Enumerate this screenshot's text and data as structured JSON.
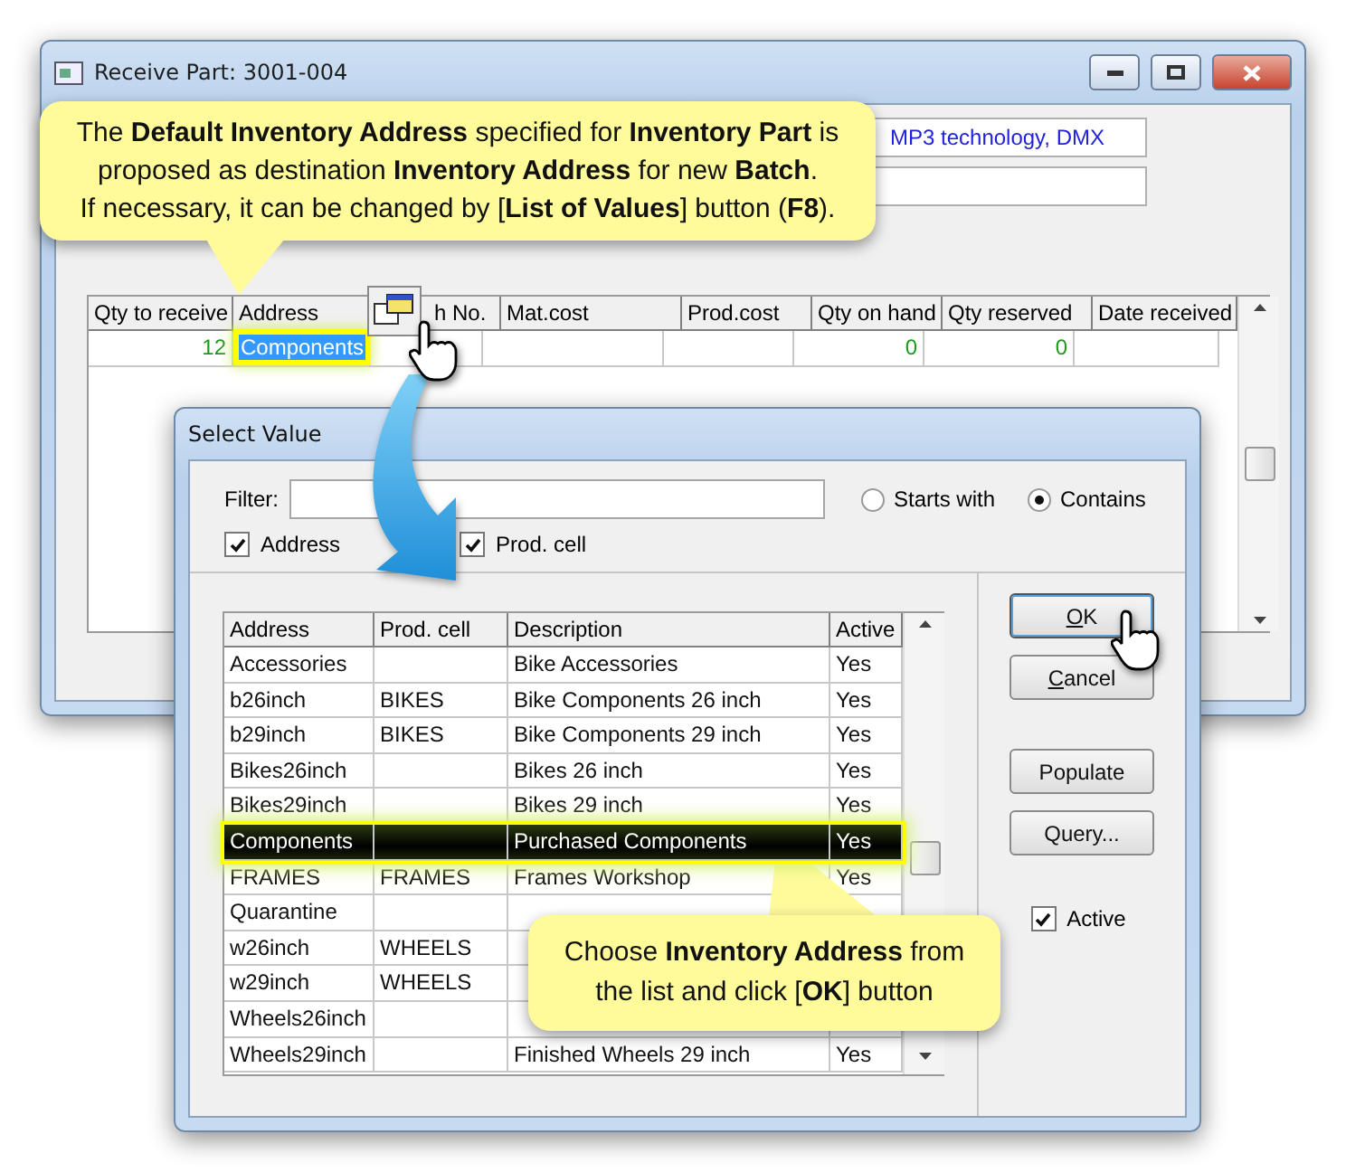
{
  "main_window": {
    "title": "Receive Part: 3001-004",
    "fields": [
      {
        "value": "MP3 technology, DMX"
      }
    ],
    "grid": {
      "columns": [
        "Qty to receive",
        "Address",
        "h No.",
        "Mat.cost",
        "Prod.cost",
        "Qty on hand",
        "Qty reserved",
        "Date received"
      ],
      "rows": [
        {
          "qty_to_receive": "12",
          "address": "Components",
          "address_selected": true,
          "qty_on_hand": "0",
          "qty_reserved": "0"
        }
      ]
    }
  },
  "callouts": [
    {
      "lines": [
        "The **Default Inventory Address** specified for **Inventory Part** is",
        "proposed as destination **Inventory Address** for new **Batch**.",
        "If necessary, it can be changed by [**List of Values**] button (**F8**)."
      ]
    },
    {
      "lines": [
        "Choose **Inventory Address** from",
        "the list and click [**OK**] button"
      ]
    }
  ],
  "dialog": {
    "title": "Select Value",
    "filter_label": "Filter:",
    "match_options": [
      {
        "label": "Starts with",
        "selected": false
      },
      {
        "label": "Contains",
        "selected": true
      }
    ],
    "search_in": [
      {
        "label": "Address",
        "checked": true
      },
      {
        "label": "Prod. cell",
        "checked": true
      }
    ],
    "list": {
      "columns": [
        "Address",
        "Prod. cell",
        "Description",
        "Active"
      ],
      "rows": [
        {
          "address": "Accessories",
          "description": "Bike Accessories",
          "active": "Yes",
          "selected": false
        },
        {
          "address": "b26inch",
          "prod_cell": "BIKES",
          "description": "Bike Components 26 inch",
          "active": "Yes",
          "selected": false
        },
        {
          "address": "b29inch",
          "prod_cell": "BIKES",
          "description": "Bike Components 29 inch",
          "active": "Yes",
          "selected": false
        },
        {
          "address": "Bikes26inch",
          "description": "Bikes 26 inch",
          "active": "Yes",
          "selected": false
        },
        {
          "address": "Bikes29inch",
          "description": "Bikes 29 inch",
          "active": "Yes",
          "selected": false
        },
        {
          "address": "Components",
          "description": "Purchased Components",
          "active": "Yes",
          "selected": true
        },
        {
          "address": "FRAMES",
          "prod_cell": "FRAMES",
          "description": "Frames Workshop",
          "active": "Yes",
          "selected": false
        },
        {
          "address": "Quarantine",
          "selected": false
        },
        {
          "address": "w26inch",
          "prod_cell": "WHEELS",
          "selected": false
        },
        {
          "address": "w29inch",
          "prod_cell": "WHEELS",
          "selected": false
        },
        {
          "address": "Wheels26inch",
          "selected": false
        },
        {
          "address": "Wheels29inch",
          "description": "Finished Wheels 29 inch",
          "active": "Yes",
          "selected": false
        }
      ]
    },
    "buttons": [
      {
        "label": "OK",
        "mnemonic": true,
        "default": true
      },
      {
        "label": "Cancel",
        "mnemonic": true,
        "default": false
      },
      {
        "label": "Populate",
        "mnemonic": false,
        "default": false
      },
      {
        "label": "Query...",
        "mnemonic": false,
        "default": false
      }
    ],
    "active_filter": {
      "label": "Active",
      "checked": true
    }
  }
}
